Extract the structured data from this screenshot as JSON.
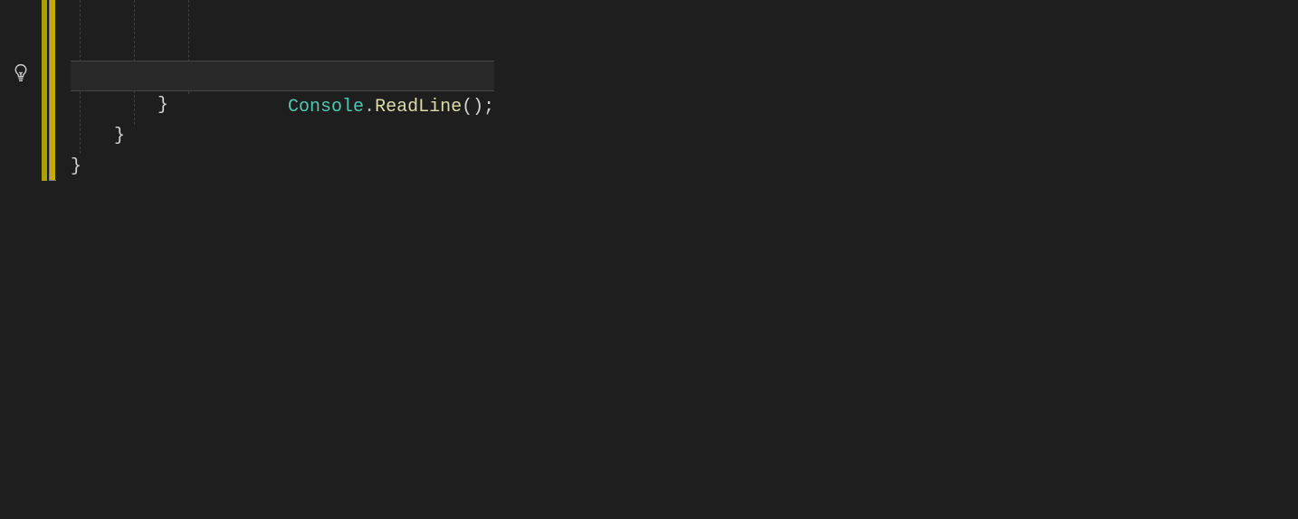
{
  "code": {
    "line0": "",
    "line1": "",
    "console": "Console",
    "dot": ".",
    "readline": "ReadLine",
    "parens": "()",
    "semicolon": ";",
    "brace1": "}",
    "brace2": "}",
    "brace3": "}"
  },
  "icons": {
    "lightbulb": "lightbulb-icon"
  }
}
